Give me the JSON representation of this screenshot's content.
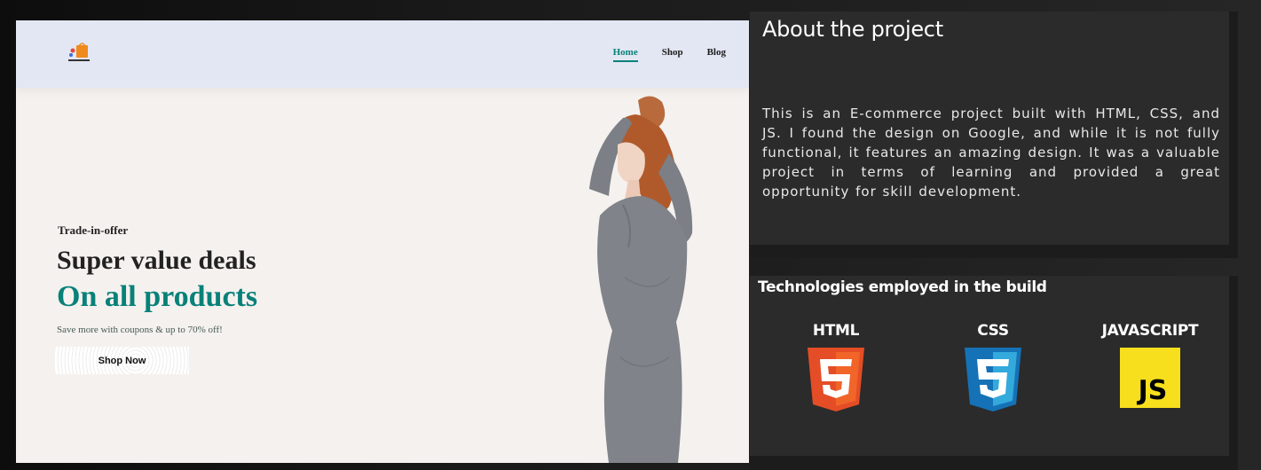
{
  "preview": {
    "logo_alt": "E-COMMERCE",
    "nav": [
      {
        "label": "Home",
        "active": true
      },
      {
        "label": "Shop",
        "active": false
      },
      {
        "label": "Blog",
        "active": false
      }
    ],
    "hero": {
      "kicker": "Trade-in-offer",
      "heading": "Super value deals",
      "highlight": "On all products",
      "subtext": "Save more with coupons & up to 70% off!",
      "button_label": "Shop Now"
    },
    "accent_color": "#088178"
  },
  "about": {
    "title": "About the project",
    "description": "This is an E-commerce project built with HTML, CSS, and JS. I found the design on Google, and while it is not fully functional, it features an amazing design. It was a valuable project in terms of learning and provided a great opportunity for skill development."
  },
  "technologies": {
    "title": "Technologies employed in the build",
    "items": [
      {
        "label": "HTML",
        "icon": "html5-icon",
        "color": "#e44d26"
      },
      {
        "label": "CSS",
        "icon": "css3-icon",
        "color": "#1572b6"
      },
      {
        "label": "JAVASCRIPT",
        "icon": "javascript-icon",
        "color": "#f7df1e"
      }
    ]
  }
}
